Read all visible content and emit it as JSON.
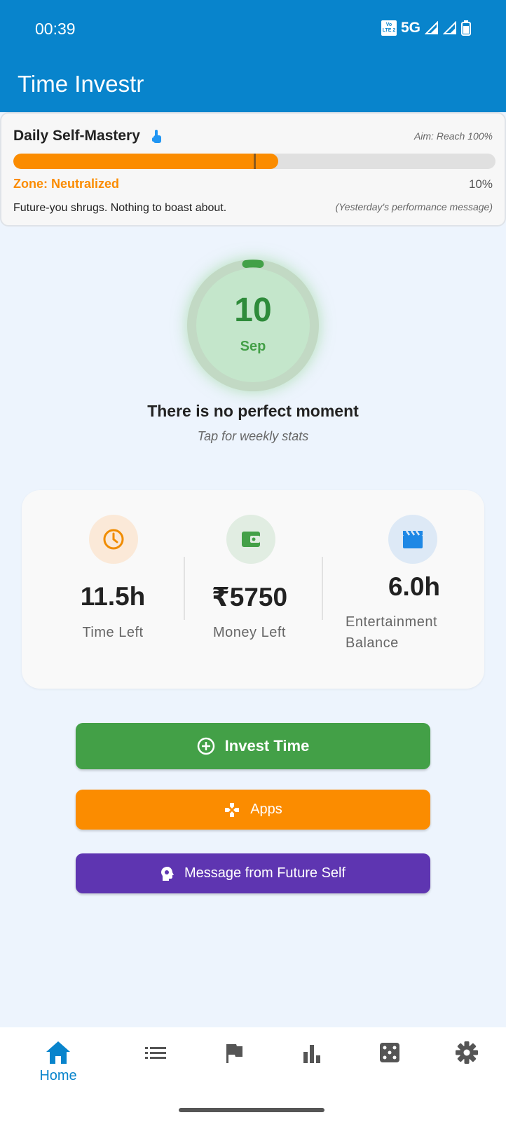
{
  "status_bar": {
    "time": "00:39",
    "volte_top": "Vo",
    "volte_bottom": "LTE 2",
    "network": "5G"
  },
  "app_bar": {
    "title": "Time Investr"
  },
  "mastery": {
    "title": "Daily Self-Mastery",
    "aim": "Aim: Reach 100%",
    "progress_fraction": 0.55,
    "zone": "Zone: Neutralized",
    "percent": "10%",
    "message": "Future-you shrugs. Nothing to boast about.",
    "note": "(Yesterday's performance message)"
  },
  "date_ring": {
    "day": "10",
    "month": "Sep"
  },
  "quote": "There is no perfect moment",
  "weekly_hint": "Tap for weekly stats",
  "stats": [
    {
      "icon": "clock-icon",
      "value": "11.5h",
      "label": "Time Left"
    },
    {
      "icon": "wallet-icon",
      "value": "₹5750",
      "label": "Money Left"
    },
    {
      "icon": "movie-icon",
      "value": "6.0h",
      "label": "Entertainment Balance"
    }
  ],
  "buttons": {
    "invest": "Invest Time",
    "apps": "Apps",
    "message": "Message from Future Self"
  },
  "nav": {
    "home": "Home"
  },
  "colors": {
    "primary": "#0884cc",
    "orange": "#fb8c00",
    "green": "#43a047",
    "purple": "#5e35b1"
  }
}
